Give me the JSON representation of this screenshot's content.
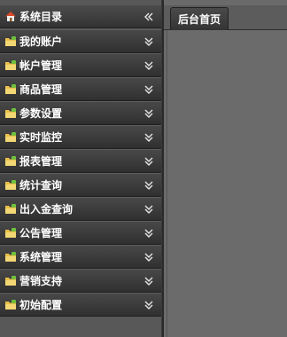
{
  "sidebar": {
    "title": "系统目录",
    "items": [
      {
        "label": "我的账户"
      },
      {
        "label": "帐户管理"
      },
      {
        "label": "商品管理"
      },
      {
        "label": "参数设置"
      },
      {
        "label": "实时监控"
      },
      {
        "label": "报表管理"
      },
      {
        "label": "统计查询"
      },
      {
        "label": "出入金查询"
      },
      {
        "label": "公告管理"
      },
      {
        "label": "系统管理"
      },
      {
        "label": "营销支持"
      },
      {
        "label": "初始配置"
      }
    ]
  },
  "tabs": [
    {
      "label": "后台首页"
    }
  ],
  "icons": {
    "header": "home-icon",
    "collapse": "double-chevron-left-icon",
    "item": "folder-icon",
    "expand": "double-chevron-down-icon"
  },
  "colors": {
    "folder": "#e8c048",
    "folder_accent": "#6fbf3f",
    "home_roof": "#d84a2a"
  }
}
